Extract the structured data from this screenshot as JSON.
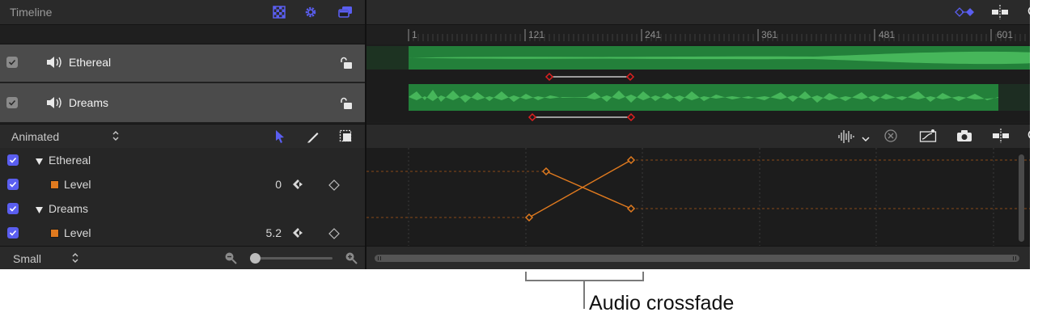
{
  "timeline": {
    "title": "Timeline",
    "ruler_marks": [
      "1",
      "121",
      "241",
      "361",
      "481",
      "601"
    ]
  },
  "tracks": [
    {
      "name": "Ethereal"
    },
    {
      "name": "Dreams"
    }
  ],
  "keyframes": {
    "filter_value": "Animated",
    "params": [
      {
        "group": "Ethereal",
        "param": "Level",
        "value": "0"
      },
      {
        "group": "Dreams",
        "param": "Level",
        "value": "5.2"
      }
    ]
  },
  "footer": {
    "size_value": "Small"
  },
  "callout": {
    "label": "Audio crossfade"
  },
  "colors": {
    "accent": "#5a5ef0",
    "waveform": "#3a8a4a",
    "keyframe": "#e07a1f",
    "fade_handle": "#e02020"
  },
  "icons": {
    "track_icon": "speaker-icon",
    "lock_icon": "unlock-icon"
  }
}
